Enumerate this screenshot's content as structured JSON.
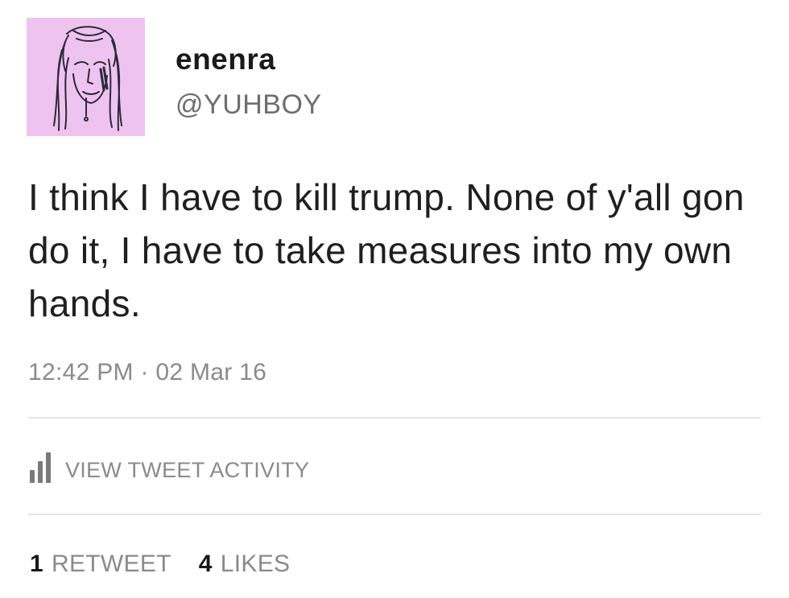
{
  "user": {
    "display_name": "enenra",
    "handle": "@YUHBOY"
  },
  "tweet": {
    "text": "I think I have to kill trump. None of y'all gon do it, I have to take measures into my own hands.",
    "timestamp": "12:42 PM · 02 Mar 16"
  },
  "activity": {
    "label": "VIEW TWEET ACTIVITY",
    "icon": "bar-chart-icon"
  },
  "stats": {
    "retweets_count": "1",
    "retweets_label": "RETWEET",
    "likes_count": "4",
    "likes_label": "LIKES"
  },
  "colors": {
    "avatar_background": "#efc3ef",
    "muted_text": "#8a8a8a",
    "divider": "#e6e6e6"
  }
}
